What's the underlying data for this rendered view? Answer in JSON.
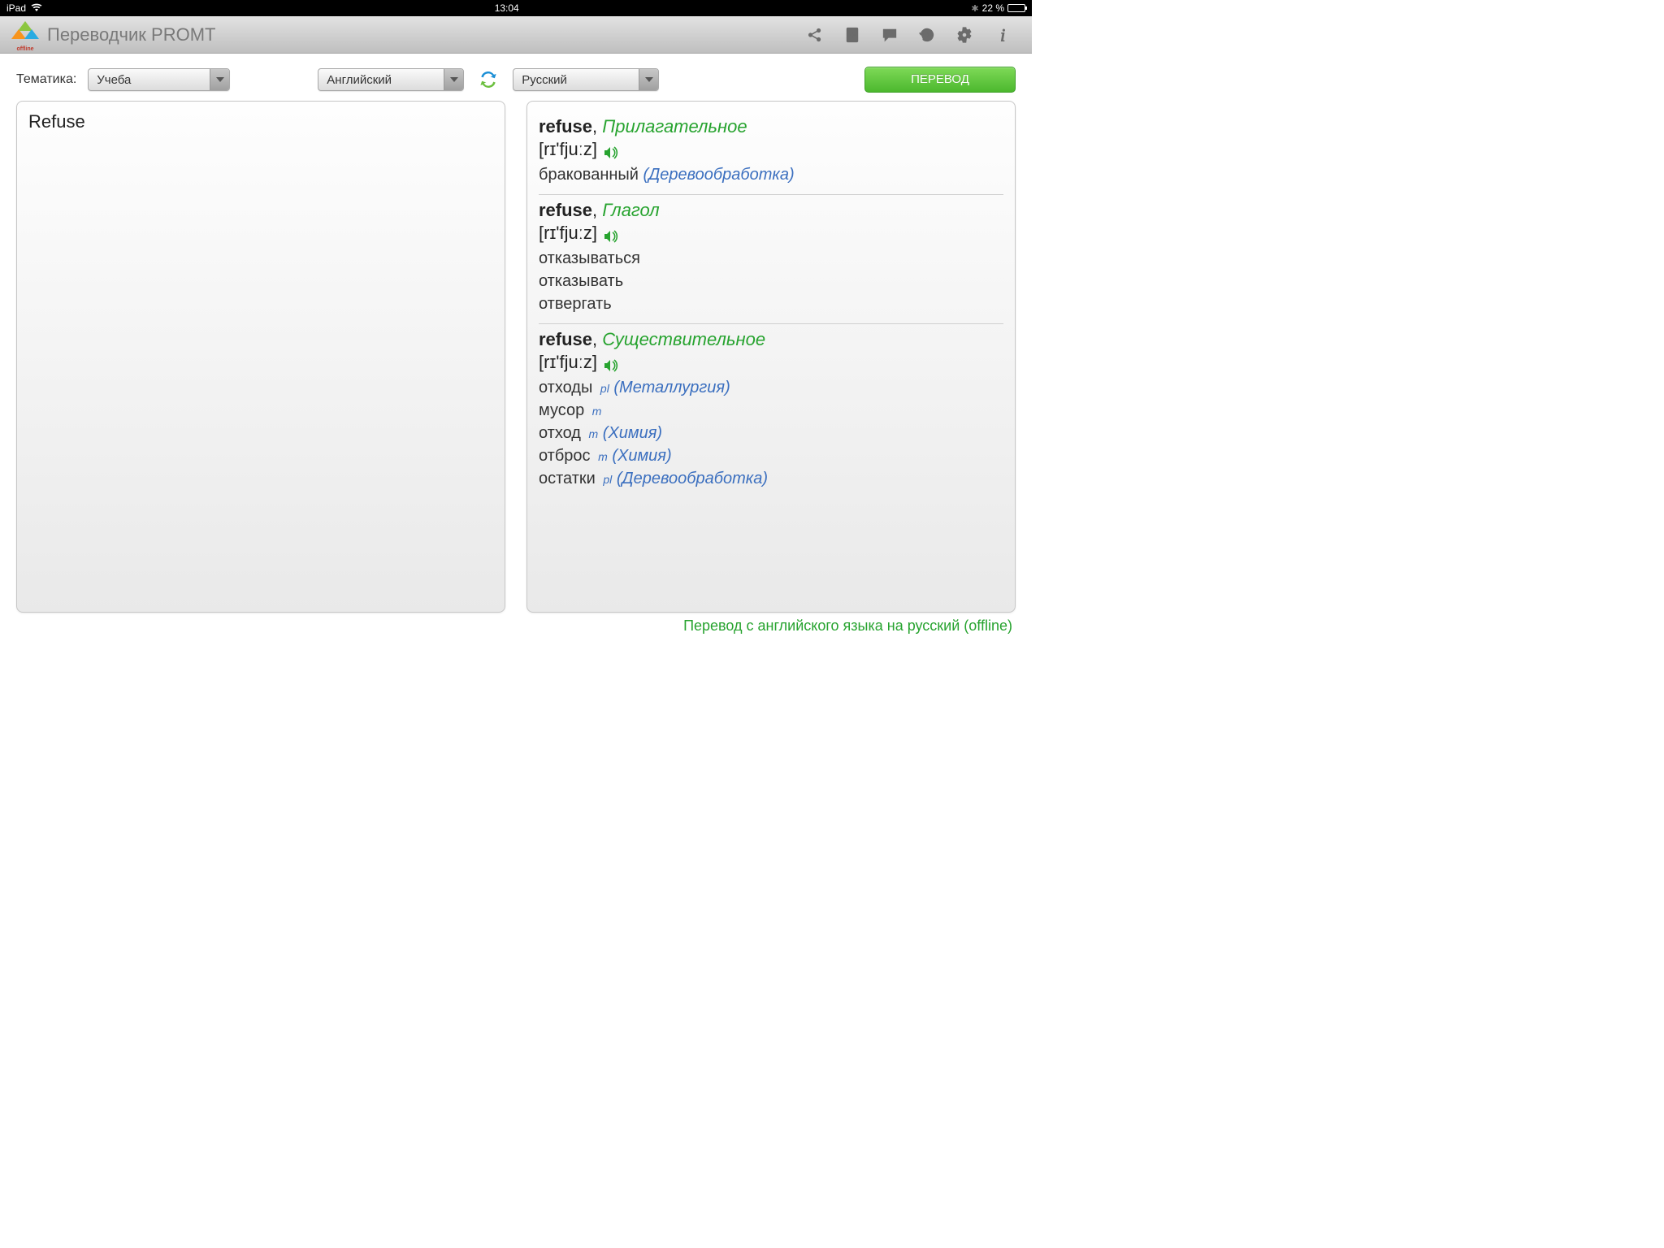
{
  "statusbar": {
    "device": "iPad",
    "time": "13:04",
    "battery_text": "22 %"
  },
  "header": {
    "title": "Переводчик PROMT",
    "logo_badge": "offline"
  },
  "controls": {
    "topic_label": "Тематика:",
    "topic_value": "Учеба",
    "source_lang": "Английский",
    "target_lang": "Русский",
    "translate_button": "ПЕРЕВОД"
  },
  "input": {
    "text": "Refuse"
  },
  "results": {
    "entries": [
      {
        "word": "refuse",
        "pos": "Прилагательное",
        "pron": "[rɪ'fjuːz]",
        "meanings": [
          {
            "text": "бракованный",
            "domain": "(Деревообработка)"
          }
        ]
      },
      {
        "word": "refuse",
        "pos": "Глагол",
        "pron": "[rɪ'fjuːz]",
        "meanings": [
          {
            "text": "отказываться"
          },
          {
            "text": "отказывать"
          },
          {
            "text": "отвергать"
          }
        ]
      },
      {
        "word": "refuse",
        "pos": "Существительное",
        "pron": "[rɪ'fjuːz]",
        "meanings": [
          {
            "text": "отходы",
            "gram": "pl",
            "domain": "(Металлургия)"
          },
          {
            "text": "мусор",
            "gram": "m"
          },
          {
            "text": "отход",
            "gram": "m",
            "domain": "(Химия)"
          },
          {
            "text": "отброс",
            "gram": "m",
            "domain": "(Химия)"
          },
          {
            "text": "остатки",
            "gram": "pl",
            "domain": "(Деревообработка)"
          }
        ]
      }
    ]
  },
  "footer": {
    "note": "Перевод с английского языка на русский (offline)"
  }
}
